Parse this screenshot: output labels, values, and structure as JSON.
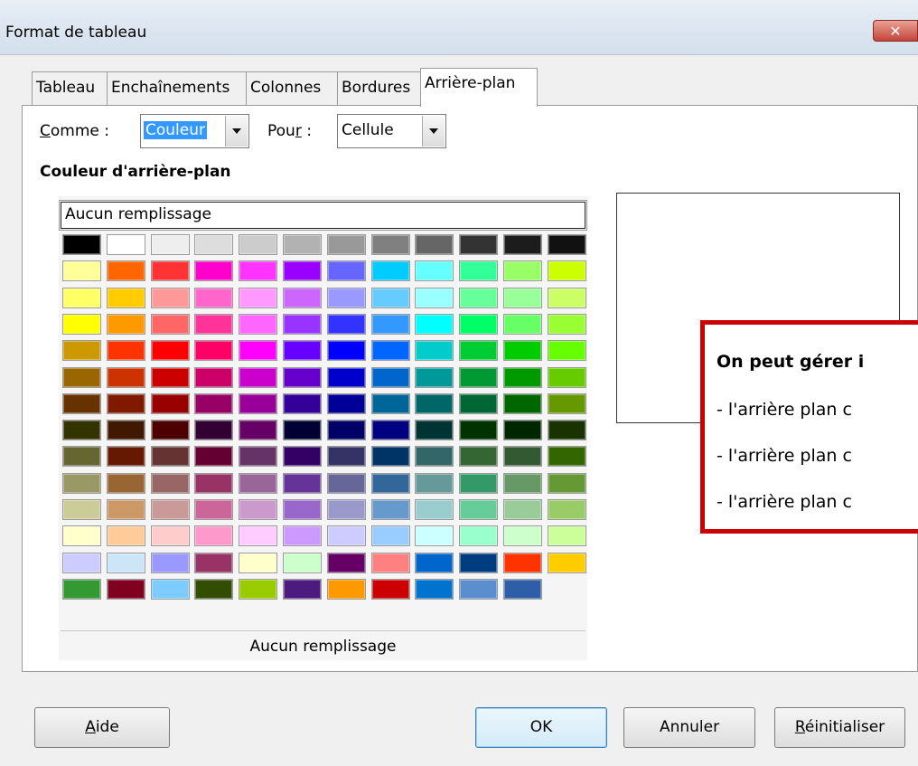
{
  "window": {
    "title": "Format de tableau",
    "close_glyph": "✕"
  },
  "tabs": [
    {
      "label": "Tableau",
      "active": false
    },
    {
      "label": "Enchaînements",
      "active": false
    },
    {
      "label": "Colonnes",
      "active": false
    },
    {
      "label": "Bordures",
      "active": false
    },
    {
      "label": "Arrière-plan",
      "active": true
    }
  ],
  "controls": {
    "comme_label_u": "C",
    "comme_label_rest": "omme :",
    "comme_value": "Couleur",
    "pour_label_pre": "Pou",
    "pour_label_u": "r",
    "pour_label_post": " :",
    "pour_value": "Cellule"
  },
  "section": {
    "title": "Couleur d'arrière-plan"
  },
  "palette": {
    "none_label": "Aucun remplissage",
    "footer_label": "Aucun remplissage",
    "rows": [
      [
        "#000000",
        "#ffffff",
        "#eeeeee",
        "#dddddd",
        "#cccccc",
        "#b2b2b2",
        "#999999",
        "#808080",
        "#666666",
        "#333333",
        "#1c1c1c",
        "#111111"
      ],
      [
        "#ffff99",
        "#ff6600",
        "#ff3333",
        "#ff00cc",
        "#ff33ff",
        "#9900ff",
        "#6666ff",
        "#00ccff",
        "#66ffff",
        "#33ff99",
        "#99ff66",
        "#ccff00"
      ],
      [
        "#ffff66",
        "#ffcc00",
        "#ff9999",
        "#ff66cc",
        "#ff99ff",
        "#cc66ff",
        "#9999ff",
        "#66ccff",
        "#99ffff",
        "#66ff99",
        "#99ff99",
        "#ccff66"
      ],
      [
        "#ffff00",
        "#ff9900",
        "#ff6666",
        "#ff3399",
        "#ff66ff",
        "#9933ff",
        "#3333ff",
        "#3399ff",
        "#00ffff",
        "#00ff66",
        "#66ff66",
        "#99ff33"
      ],
      [
        "#cc9900",
        "#ff3300",
        "#ff0000",
        "#ff0066",
        "#ff00ff",
        "#6600ff",
        "#0000ff",
        "#0066ff",
        "#00cccc",
        "#00cc33",
        "#00cc00",
        "#66ff00"
      ],
      [
        "#996600",
        "#cc3300",
        "#cc0000",
        "#cc0066",
        "#cc00cc",
        "#6600cc",
        "#0000cc",
        "#0066cc",
        "#009999",
        "#009933",
        "#009900",
        "#66cc00"
      ],
      [
        "#663300",
        "#801900",
        "#990000",
        "#990066",
        "#990099",
        "#330099",
        "#000099",
        "#006699",
        "#006666",
        "#006633",
        "#006600",
        "#669900"
      ],
      [
        "#333300",
        "#401900",
        "#4c0000",
        "#330033",
        "#660066",
        "#000033",
        "#000066",
        "#000080",
        "#003333",
        "#003300",
        "#002600",
        "#193300"
      ],
      [
        "#666633",
        "#661900",
        "#663333",
        "#660033",
        "#663366",
        "#330066",
        "#333366",
        "#003366",
        "#336666",
        "#336633",
        "#335933",
        "#336600"
      ],
      [
        "#999966",
        "#996633",
        "#996666",
        "#993366",
        "#996699",
        "#663399",
        "#666699",
        "#336699",
        "#669999",
        "#339966",
        "#669966",
        "#669933"
      ],
      [
        "#cccc99",
        "#cc9966",
        "#cc9999",
        "#cc6699",
        "#cc99cc",
        "#9966cc",
        "#9999cc",
        "#6699cc",
        "#99cccc",
        "#66cc99",
        "#99cc99",
        "#99cc66"
      ],
      [
        "#ffffcc",
        "#ffcc99",
        "#ffcccc",
        "#ff99cc",
        "#ffccff",
        "#cc99ff",
        "#ccccff",
        "#99ccff",
        "#ccffff",
        "#99ffcc",
        "#ccffcc",
        "#ccff99"
      ],
      [
        "#ccccff",
        "#cce5f7",
        "#9999ff",
        "#993366",
        "#ffffcc",
        "#ccffcc",
        "#660066",
        "#ff8080",
        "#0066cc",
        "#003d80",
        "#ff3300",
        "#ffcc00"
      ],
      [
        "#339933",
        "#800020",
        "#7ecbff",
        "#334d00",
        "#99cc00",
        "#4d1a80",
        "#ff9900",
        "#cc0000",
        "#0073cf",
        "#5b8ecf",
        "#2e5ea8"
      ]
    ]
  },
  "callout": {
    "line1": "On peut gérer i",
    "line2": "- l'arrière plan c",
    "line3": "- l'arrière plan c",
    "line4": "- l'arrière plan c"
  },
  "buttons": {
    "aide_u": "A",
    "aide_rest": "ide",
    "ok": "OK",
    "annuler": "Annuler",
    "reset_u": "R",
    "reset_rest": "éinitialiser"
  }
}
